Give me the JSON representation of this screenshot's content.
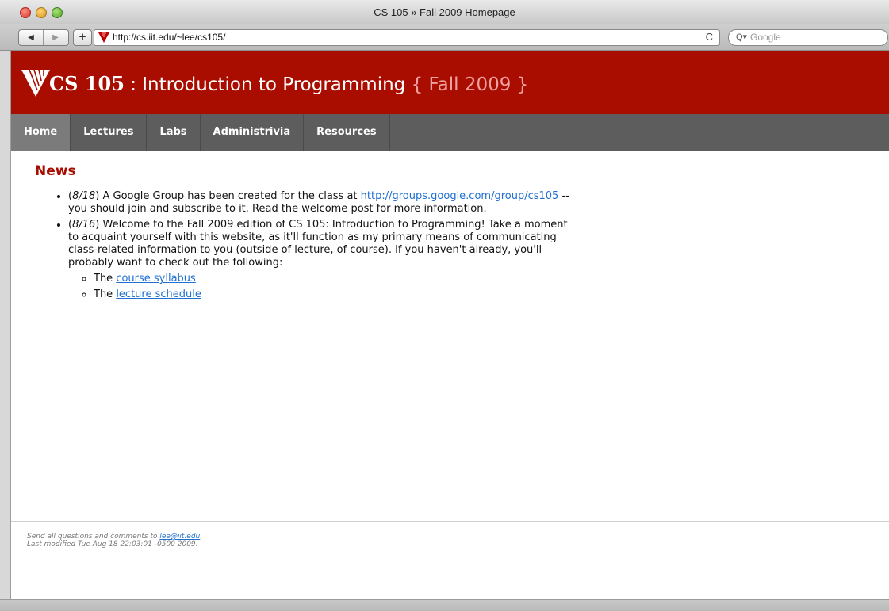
{
  "window": {
    "title": "CS 105 » Fall 2009 Homepage"
  },
  "toolbar": {
    "back_icon": "◀",
    "forward_icon": "▶",
    "add_icon": "+",
    "url": "http://cs.iit.edu/~lee/cs105/",
    "reload_icon": "C",
    "search_placeholder": "Google",
    "search_icon": "Q▾"
  },
  "header": {
    "course_code": "CS 105",
    "separator": " : ",
    "course_name": "Introduction to Programming",
    "term": " { Fall 2009 }",
    "brand_color": "#a80d00"
  },
  "nav": {
    "items": [
      {
        "label": "Home"
      },
      {
        "label": "Lectures"
      },
      {
        "label": "Labs"
      },
      {
        "label": "Administrivia"
      },
      {
        "label": "Resources"
      }
    ]
  },
  "news": {
    "heading": "News",
    "item1": {
      "date": "8/18",
      "text_a": " A Google Group has been created for the class at ",
      "link": "http://groups.google.com/group/cs105",
      "text_b": " -- you should join and subscribe to it. Read the welcome post for more information."
    },
    "item2": {
      "date": "8/16",
      "text": " Welcome to the Fall 2009 edition of CS 105: Introduction to Programming! Take a moment to acquaint yourself with this website, as it'll function as my primary means of communicating class-related information to you (outside of lecture, of course). If you haven't already, you'll probably want to check out the following:",
      "subitems": [
        {
          "prefix": "The ",
          "link": "course syllabus"
        },
        {
          "prefix": "The ",
          "link": "lecture schedule"
        }
      ]
    }
  },
  "footer": {
    "line1_prefix": "Send all questions and comments to ",
    "email": "lee@iit.edu",
    "line1_suffix": ".",
    "line2": "Last modified Tue Aug 18 22:03:01 -0500 2009."
  }
}
